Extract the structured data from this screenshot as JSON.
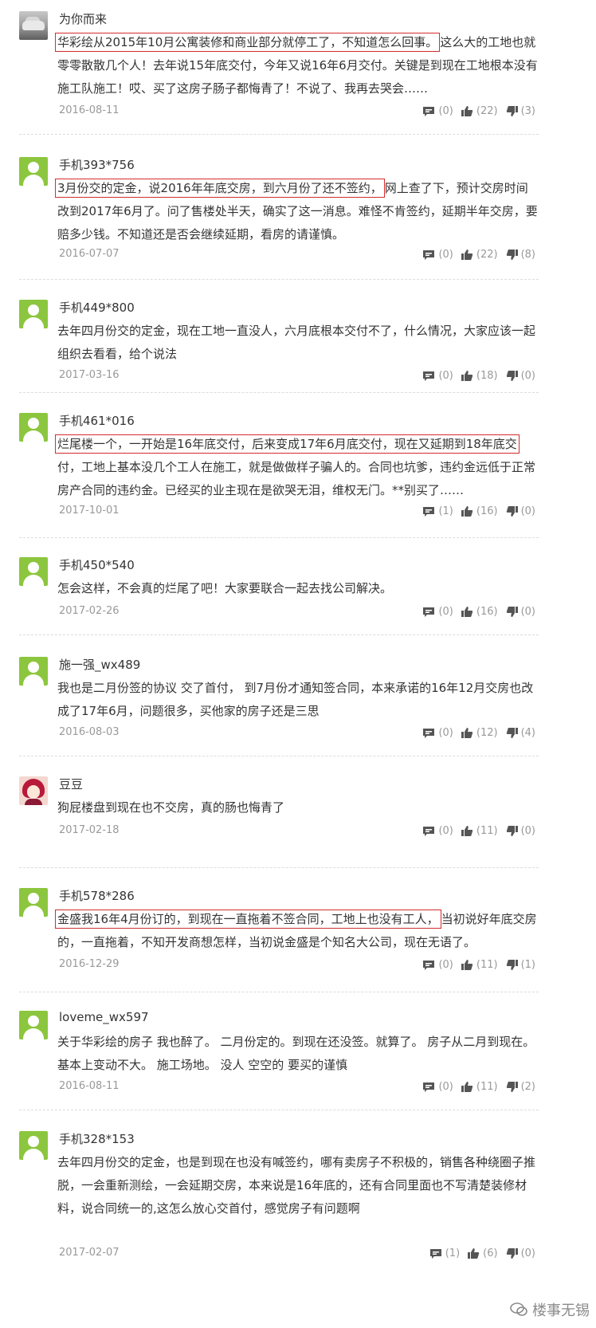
{
  "comments": [
    {
      "user": "为你而来",
      "avatar": "car-photo",
      "date": "2016-08-11",
      "comments_count": "(0)",
      "likes": "(22)",
      "dislikes": "(3)",
      "highlight": "华彩绘从2015年10月公寓装修和商业部分就停工了，不知道怎么回事。",
      "text_rest": "这么大的工地也就零零散散几个人！去年说15年底交付，今年又说16年6月交付。关键是到现在工地根本没有施工队施工！哎、买了这房子肠子都悔青了！不说了、我再去哭会……"
    },
    {
      "user": "手机393*756",
      "avatar": "default",
      "date": "2016-07-07",
      "comments_count": "(0)",
      "likes": "(22)",
      "dislikes": "(8)",
      "highlight": "3月份交的定金，说2016年年底交房，到六月份了还不签约，",
      "text_rest": "网上查了下，预计交房时间改到2017年6月了。问了售楼处半天，确实了这一消息。难怪不肯签约，延期半年交房，要赔多少钱。不知道还是否会继续延期，看房的请谨慎。"
    },
    {
      "user": "手机449*800",
      "avatar": "default",
      "date": "2017-03-16",
      "comments_count": "(0)",
      "likes": "(18)",
      "dislikes": "(0)",
      "highlight": "",
      "text_rest": "去年四月份交的定金，现在工地一直没人，六月底根本交付不了，什么情况，大家应该一起组织去看看，给个说法"
    },
    {
      "user": "手机461*016",
      "avatar": "default",
      "date": "2017-10-01",
      "comments_count": "(1)",
      "likes": "(16)",
      "dislikes": "(0)",
      "highlight": "烂尾楼一个，一开始是16年底交付，后来变成17年6月底交付，现在又延期到18年底交",
      "text_rest": "付，工地上基本没几个工人在施工，就是做做样子骗人的。合同也坑爹，违约金远低于正常房产合同的违约金。已经买的业主现在是欲哭无泪，维权无门。**别买了……"
    },
    {
      "user": "手机450*540",
      "avatar": "default",
      "date": "2017-02-26",
      "comments_count": "(0)",
      "likes": "(16)",
      "dislikes": "(0)",
      "highlight": "",
      "text_rest": "怎会这样，不会真的烂尾了吧！大家要联合一起去找公司解决。"
    },
    {
      "user": "施一强_wx489",
      "avatar": "default",
      "date": "2016-08-03",
      "comments_count": "(0)",
      "likes": "(12)",
      "dislikes": "(4)",
      "highlight": "",
      "text_rest": "我也是二月份签的协议 交了首付， 到7月份才通知签合同，本来承诺的16年12月交房也改成了17年6月，问题很多，买他家的房子还是三思"
    },
    {
      "user": "豆豆",
      "avatar": "cartoon",
      "date": "2017-02-18",
      "comments_count": "(0)",
      "likes": "(11)",
      "dislikes": "(0)",
      "highlight": "",
      "text_rest": "狗屁楼盘到现在也不交房，真的肠也悔青了"
    },
    {
      "user": "手机578*286",
      "avatar": "default",
      "date": "2016-12-29",
      "comments_count": "(0)",
      "likes": "(11)",
      "dislikes": "(1)",
      "highlight": "金盛我16年4月份订的，到现在一直拖着不签合同，工地上也没有工人，",
      "text_rest": "当初说好年底交房的，一直拖着，不知开发商想怎样，当初说金盛是个知名大公司，现在无语了。"
    },
    {
      "user": "loveme_wx597",
      "avatar": "default",
      "date": "2016-08-11",
      "comments_count": "(0)",
      "likes": "(11)",
      "dislikes": "(2)",
      "highlight": "",
      "text_rest": "关于华彩绘的房子 我也醉了。 二月份定的。到现在还没签。就算了。 房子从二月到现在。 基本上变动不大。 施工场地。 没人 空空的 要买的谨慎"
    },
    {
      "user": "手机328*153",
      "avatar": "default",
      "date": "2017-02-07",
      "comments_count": "(1)",
      "likes": "(6)",
      "dislikes": "(0)",
      "highlight": "",
      "text_rest": "去年四月份交的定金，也是到现在也没有喊签约，哪有卖房子不积极的，销售各种绕圈子推脱，一会重新测绘，一会延期交房，本来说是16年底的，还有合同里面也不写清楚装修材料，说合同统一的,这怎么放心交首付，感觉房子有问题啊"
    }
  ],
  "watermark": "楼事无锡",
  "colors": {
    "highlight_border": "#d32c2c",
    "avatar_green": "#8cc63f",
    "meta_gray": "#999999"
  }
}
